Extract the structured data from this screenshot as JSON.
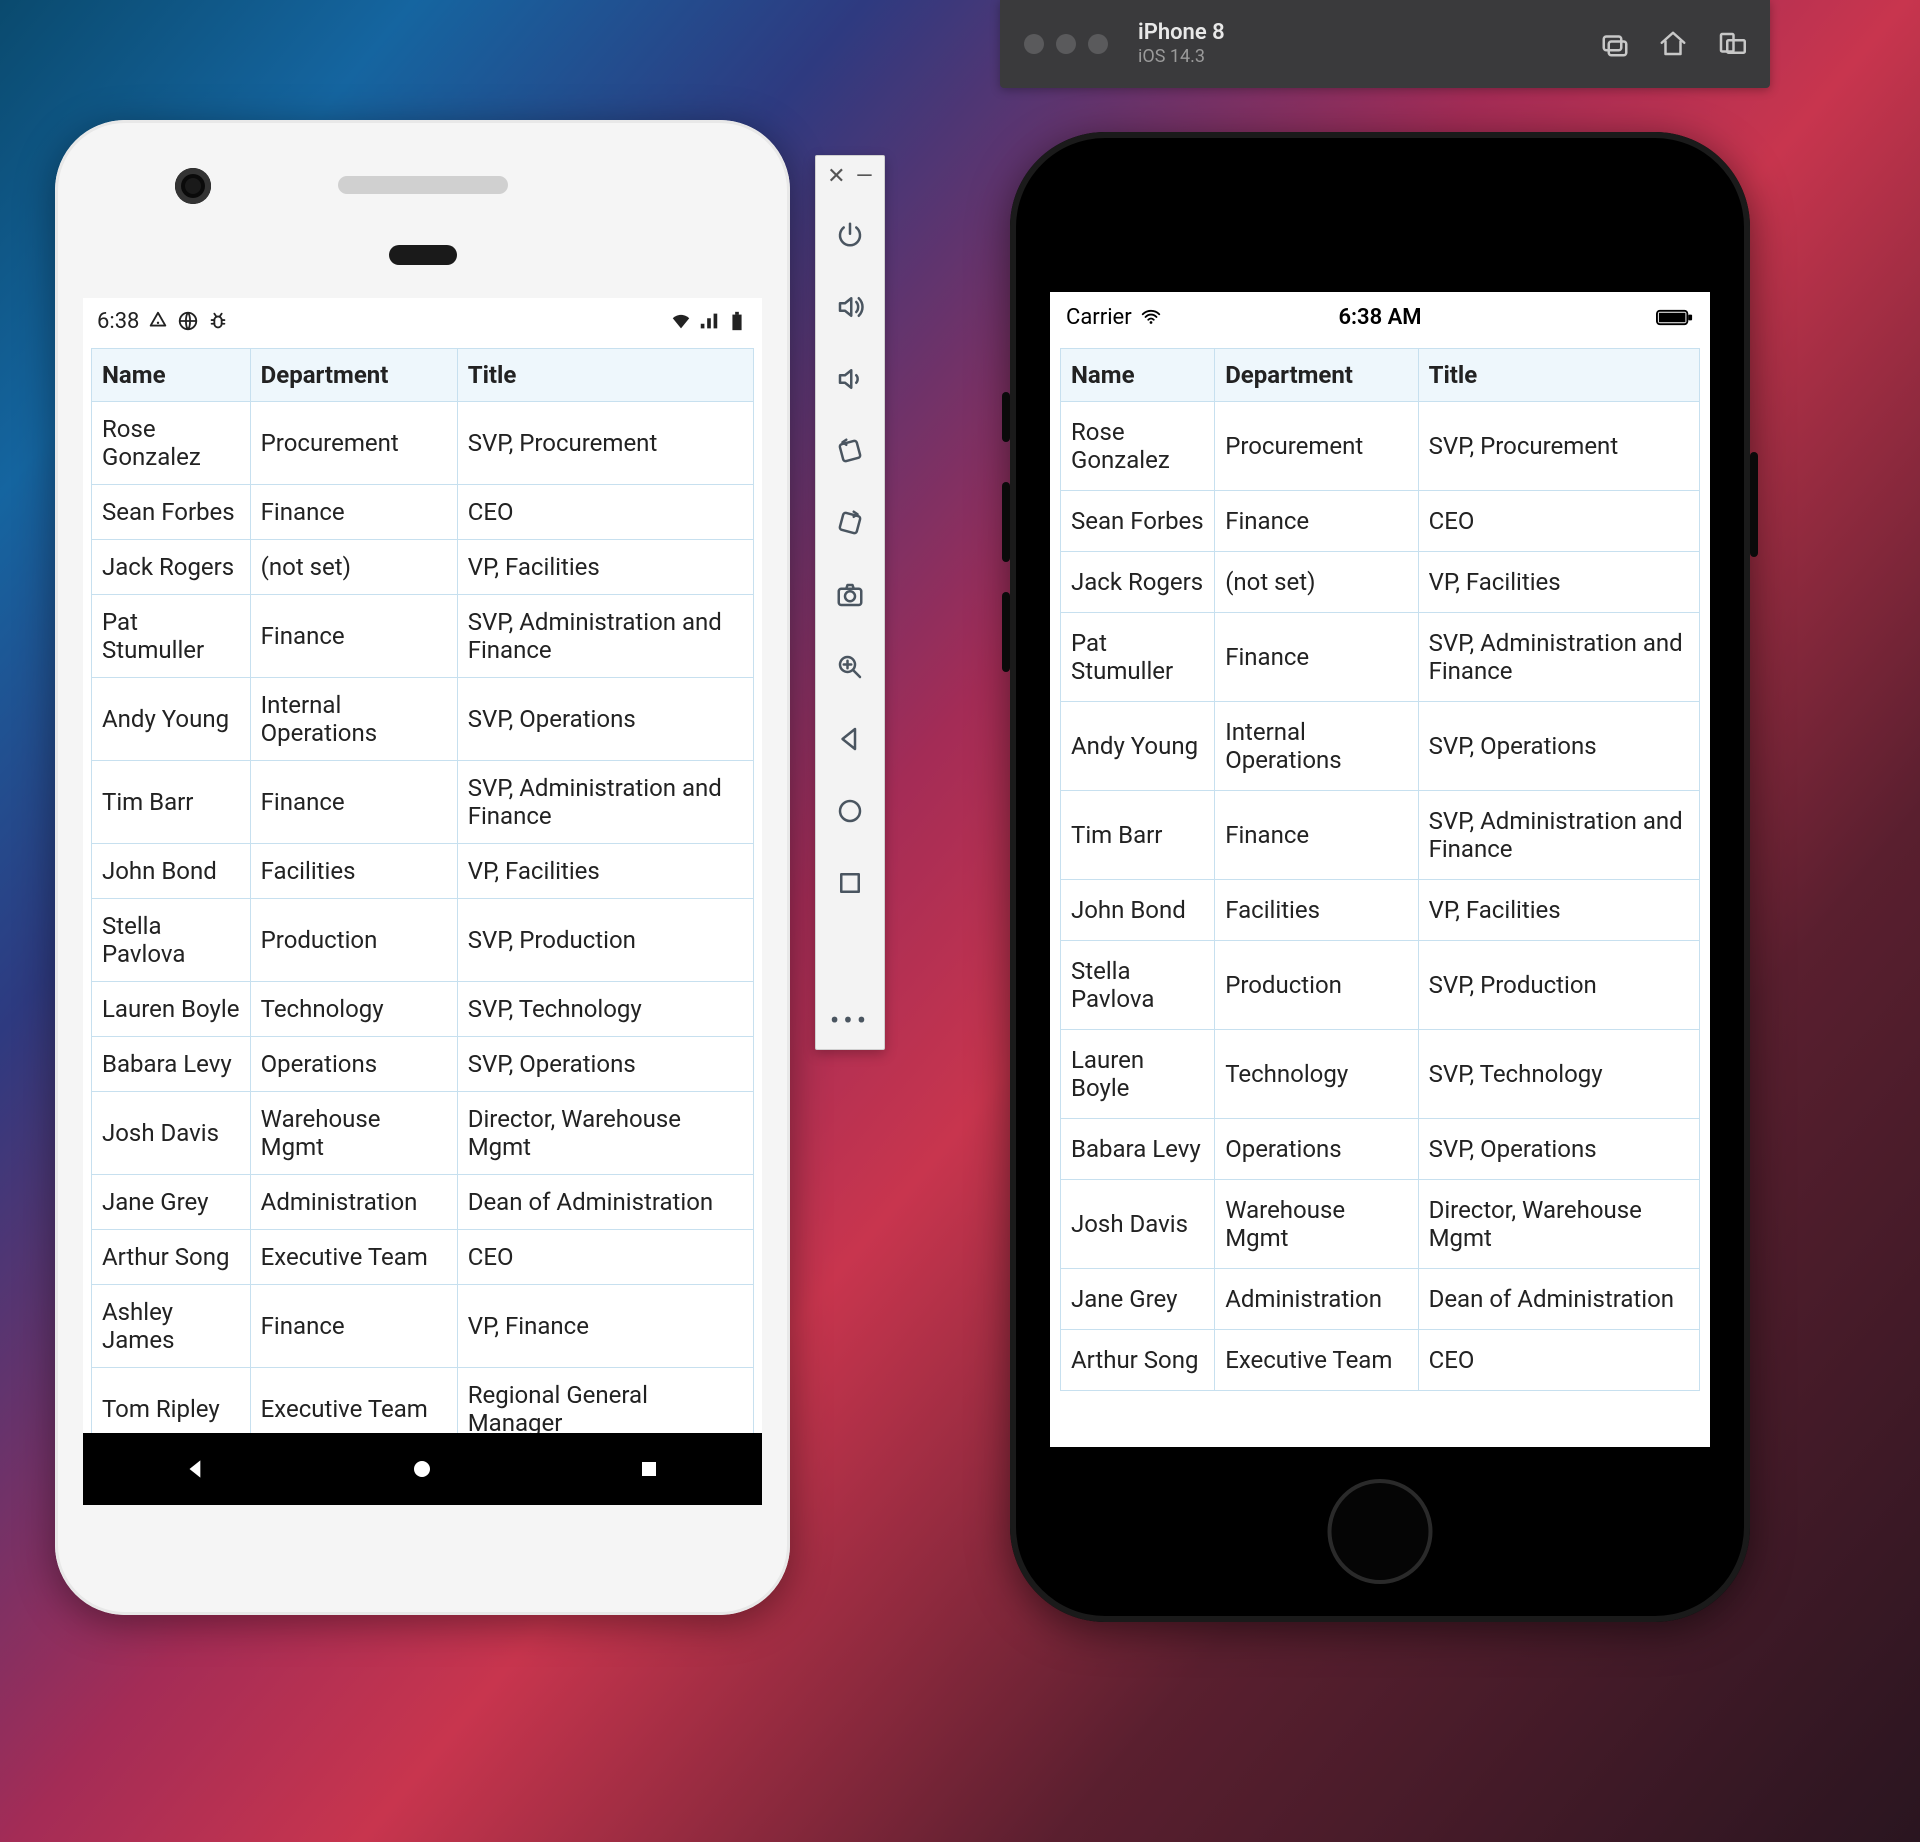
{
  "simulator_window": {
    "device_name": "iPhone 8",
    "os_version": "iOS 14.3"
  },
  "android_status": {
    "time": "6:38"
  },
  "ios_status": {
    "carrier": "Carrier",
    "time": "6:38 AM"
  },
  "table": {
    "headers": {
      "col0": "Name",
      "col1": "Department",
      "col2": "Title"
    },
    "rows": [
      {
        "name": "Rose Gonzalez",
        "department": "Procurement",
        "title": "SVP, Procurement"
      },
      {
        "name": "Sean Forbes",
        "department": "Finance",
        "title": "CEO"
      },
      {
        "name": "Jack Rogers",
        "department": "(not set)",
        "title": "VP, Facilities"
      },
      {
        "name": "Pat Stumuller",
        "department": "Finance",
        "title": "SVP, Administration and Finance"
      },
      {
        "name": "Andy Young",
        "department": "Internal Operations",
        "title": "SVP, Operations"
      },
      {
        "name": "Tim Barr",
        "department": "Finance",
        "title": "SVP, Administration and Finance"
      },
      {
        "name": "John Bond",
        "department": "Facilities",
        "title": "VP, Facilities"
      },
      {
        "name": "Stella Pavlova",
        "department": "Production",
        "title": "SVP, Production"
      },
      {
        "name": "Lauren Boyle",
        "department": "Technology",
        "title": "SVP, Technology"
      },
      {
        "name": "Babara Levy",
        "department": "Operations",
        "title": "SVP, Operations"
      },
      {
        "name": "Josh Davis",
        "department": "Warehouse Mgmt",
        "title": "Director, Warehouse Mgmt"
      },
      {
        "name": "Jane Grey",
        "department": "Administration",
        "title": "Dean of Administration"
      },
      {
        "name": "Arthur Song",
        "department": "Executive Team",
        "title": "CEO"
      },
      {
        "name": "Ashley James",
        "department": "Finance",
        "title": "VP, Finance"
      },
      {
        "name": "Tom Ripley",
        "department": "Executive Team",
        "title": "Regional General Manager"
      }
    ]
  },
  "android_visible_rows": 15,
  "ios_visible_rows": 13
}
